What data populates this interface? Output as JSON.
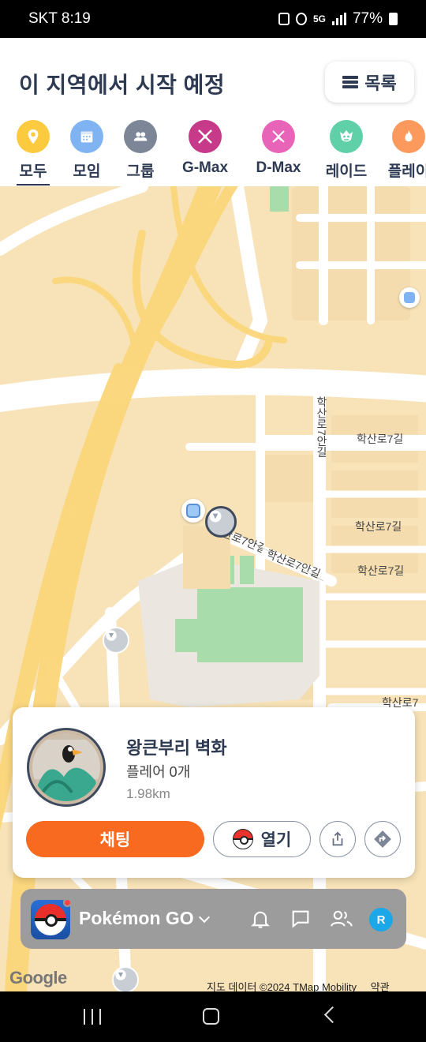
{
  "status_bar": {
    "carrier_time": "SKT 8:19",
    "battery": "77%",
    "network": "5G"
  },
  "header": {
    "title": "이 지역에서 시작 예정",
    "list_button": "목록"
  },
  "categories": [
    {
      "label": "모두",
      "color": "#fbca3e",
      "icon": "location-pin-icon",
      "selected": true
    },
    {
      "label": "모임",
      "color": "#7fb3f2",
      "icon": "calendar-icon"
    },
    {
      "label": "그룹",
      "color": "#7d8696",
      "icon": "people-icon"
    },
    {
      "label": "G-Max",
      "color": "#c73a8a",
      "icon": "gmax-icon"
    },
    {
      "label": "D-Max",
      "color": "#e864b8",
      "icon": "dmax-icon"
    },
    {
      "label": "레이드",
      "color": "#5fd0a8",
      "icon": "raid-monster-icon"
    },
    {
      "label": "플레이",
      "color": "#fb9a5c",
      "icon": "fire-icon"
    }
  ],
  "map": {
    "street_labels": [
      "학산로7안길",
      "학산로7길",
      "학산로7길",
      "학산로7길",
      "학산로7안길",
      "학산로7안길",
      "학산로7"
    ],
    "google": "Google",
    "credit": "지도 데이터 ©2024 TMap Mobility",
    "terms": "약관"
  },
  "card": {
    "name": "왕큰부리 벽화",
    "players": "플레어 0개",
    "distance": "1.98km",
    "chat_button": "채팅",
    "open_button": "열기"
  },
  "app_bar": {
    "name": "Pokémon GO",
    "profile_initial": "R"
  }
}
